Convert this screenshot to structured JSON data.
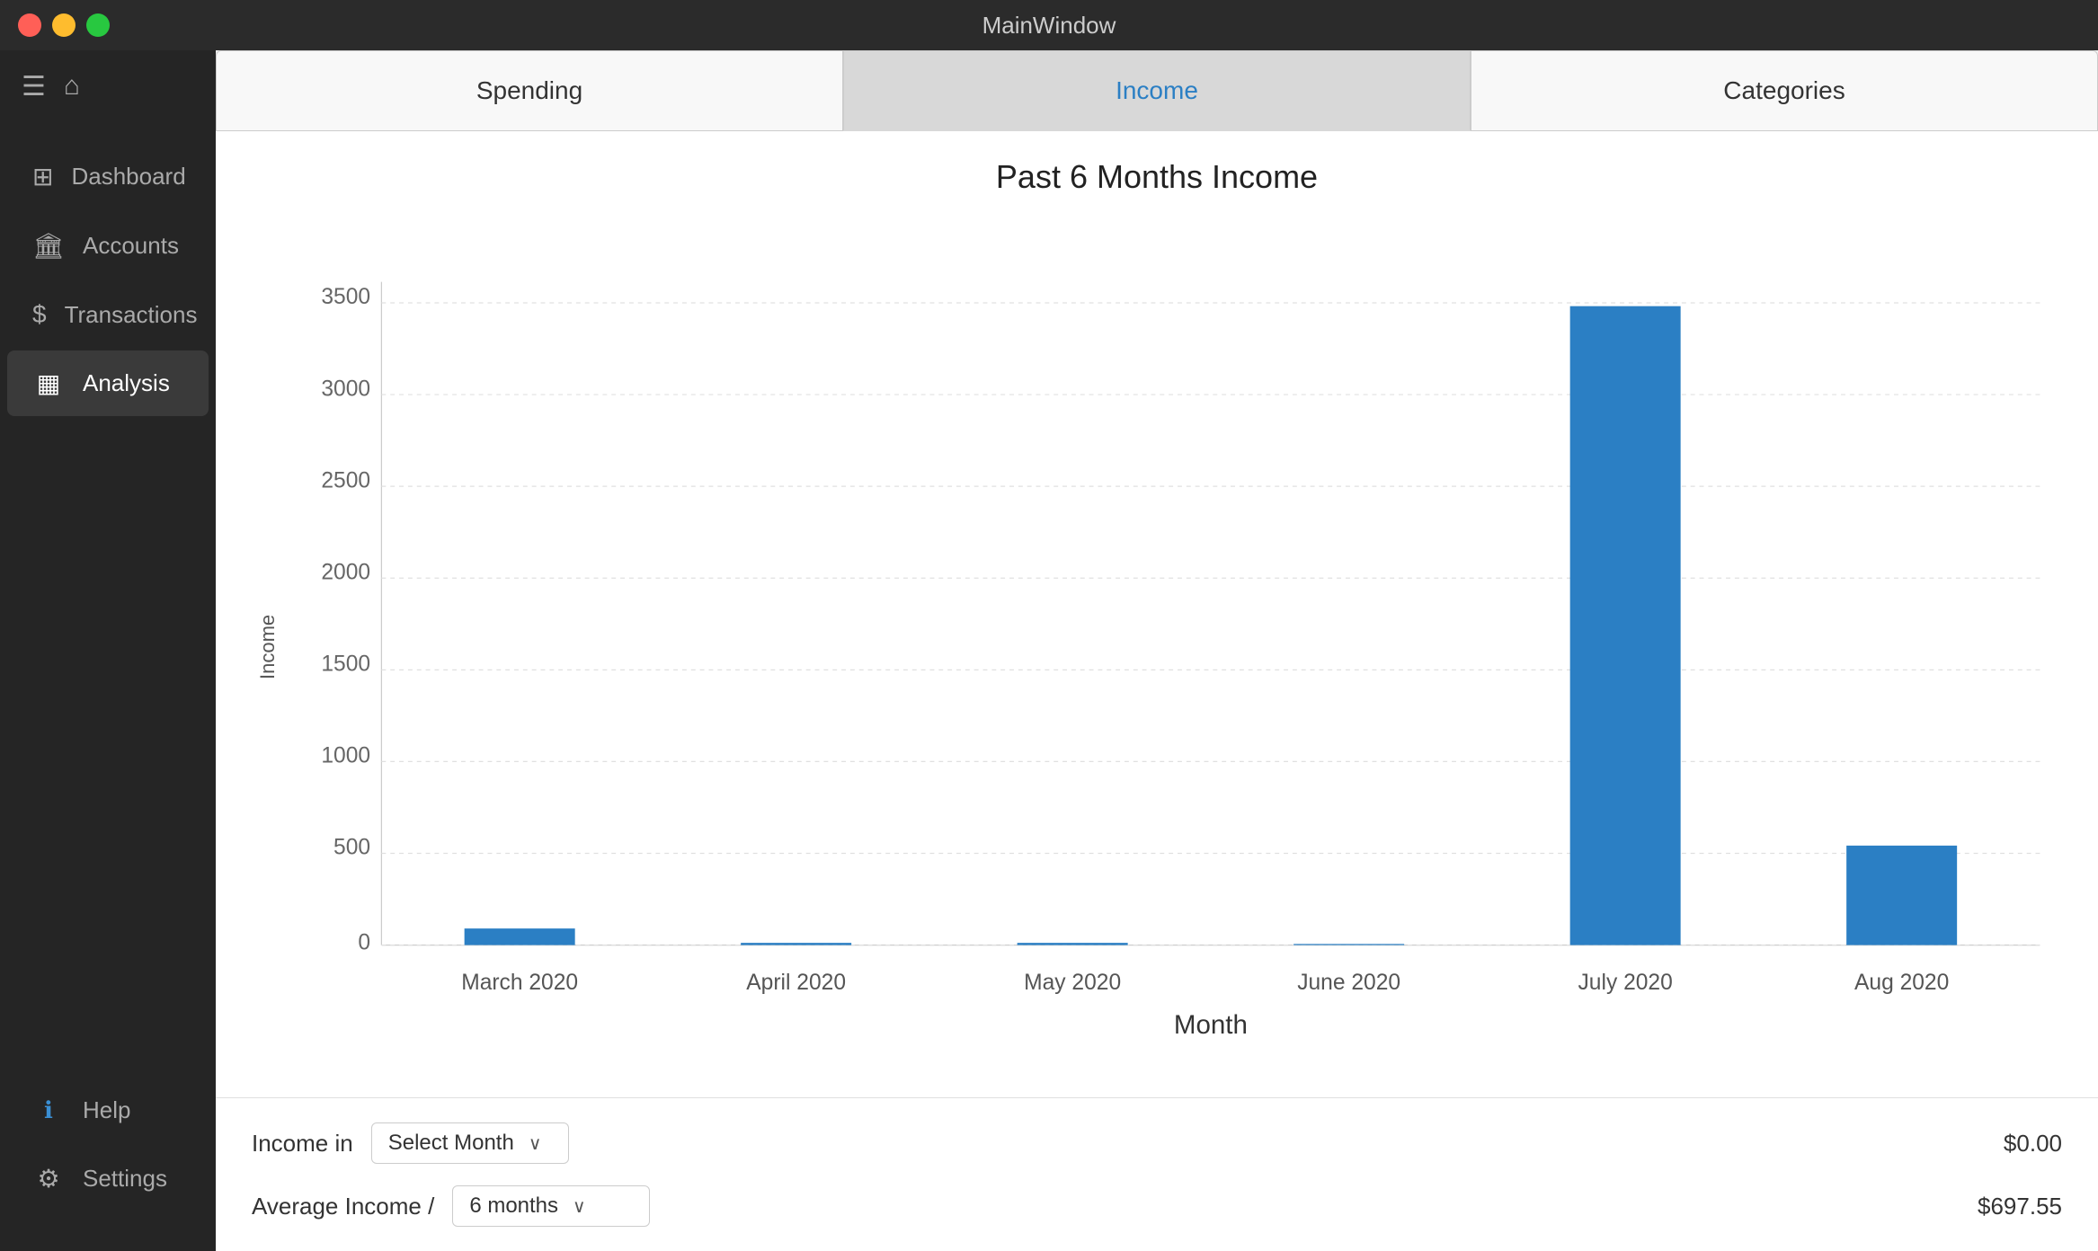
{
  "titlebar": {
    "title": "MainWindow"
  },
  "sidebar": {
    "items": [
      {
        "id": "dashboard",
        "label": "Dashboard",
        "icon": "⊞",
        "active": false
      },
      {
        "id": "accounts",
        "label": "Accounts",
        "icon": "🏛",
        "active": false
      },
      {
        "id": "transactions",
        "label": "Transactions",
        "icon": "💲",
        "active": false
      },
      {
        "id": "analysis",
        "label": "Analysis",
        "icon": "📊",
        "active": true
      }
    ],
    "bottom_items": [
      {
        "id": "help",
        "label": "Help",
        "icon": "ℹ",
        "active": false
      },
      {
        "id": "settings",
        "label": "Settings",
        "icon": "⚙",
        "active": false
      }
    ]
  },
  "tabs": [
    {
      "id": "spending",
      "label": "Spending",
      "active": false
    },
    {
      "id": "income",
      "label": "Income",
      "active": true
    },
    {
      "id": "categories",
      "label": "Categories",
      "active": false
    }
  ],
  "chart": {
    "title": "Past 6 Months Income",
    "y_axis_label": "Income",
    "x_axis_label": "Month",
    "y_ticks": [
      "0",
      "500",
      "1000",
      "1500",
      "2000",
      "2500",
      "3000",
      "3500"
    ],
    "bars": [
      {
        "month": "March 2020",
        "value": 90
      },
      {
        "month": "April 2020",
        "value": 12
      },
      {
        "month": "May 2020",
        "value": 10
      },
      {
        "month": "June 2020",
        "value": 8
      },
      {
        "month": "July 2020",
        "value": 3490
      },
      {
        "month": "Aug 2020",
        "value": 540
      }
    ],
    "max_value": 3500,
    "bar_color": "#2b7fc4"
  },
  "controls": {
    "income_in_label": "Income in",
    "income_in_dropdown": "Select Month",
    "income_in_value": "$0.00",
    "avg_income_label": "Average Income /",
    "avg_income_dropdown": "6 months",
    "avg_income_value": "$697.55"
  }
}
